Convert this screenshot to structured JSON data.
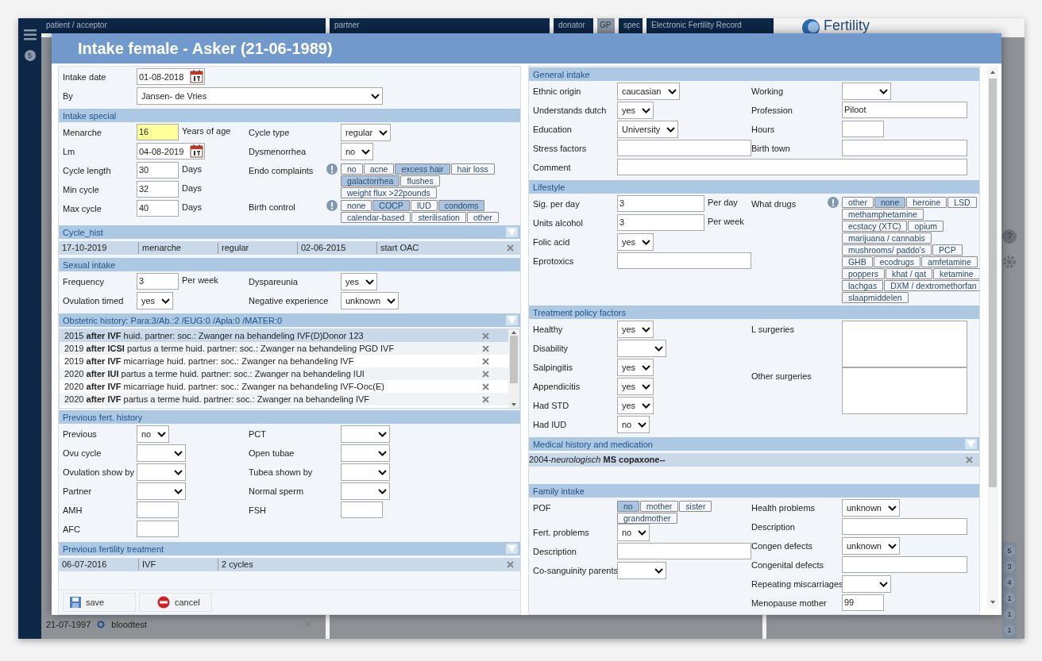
{
  "app": {
    "menu_badge": "5",
    "header": [
      {
        "label": "patient / acceptor",
        "kind": "bar"
      },
      {
        "label": "partner",
        "kind": "bar"
      },
      {
        "label": "donator",
        "kind": "bar"
      },
      {
        "label": "GP",
        "kind": "tab"
      },
      {
        "label": "spec",
        "kind": "bar"
      },
      {
        "label": "Electronic Fertility Record",
        "kind": "bar"
      }
    ],
    "logo": "Fertility",
    "help": "?",
    "side_badges": [
      "5",
      "3",
      "4",
      "1",
      "1",
      "1"
    ],
    "bottom_entry": {
      "date": "21-07-1997",
      "label": "bloodtest"
    }
  },
  "dialog": {
    "title": "Intake female - Asker (21-06-1989)",
    "left": [
      {
        "kind": "form",
        "left": [
          {
            "label": "Intake date",
            "kind": "date",
            "value": "01-08-2018"
          },
          {
            "label": "By",
            "kind": "select",
            "value": "Jansen- de Vries"
          }
        ]
      },
      {
        "title": "Intake special",
        "kind": "form",
        "collapsible": false,
        "left": [
          {
            "label": "Menarche",
            "kind": "number",
            "value": "16",
            "unit": "Years of age",
            "highlighted": true
          },
          {
            "label": "Lm",
            "kind": "date",
            "value": "04-08-2019"
          },
          {
            "label": "Cycle length",
            "kind": "number",
            "value": "30",
            "unit": "Days"
          },
          {
            "label": "Min cycle",
            "kind": "number",
            "value": "32",
            "unit": "Days"
          },
          {
            "label": "Max cycle",
            "kind": "number",
            "value": "40",
            "unit": "Days"
          }
        ],
        "right": [
          {
            "label": "Cycle type",
            "kind": "select",
            "value": "regular"
          },
          {
            "label": "Dysmenorrhea",
            "kind": "select",
            "value": "no"
          },
          {
            "label": "Endo complaints",
            "kind": "chips",
            "warning": true,
            "options": [
              {
                "label": "no",
                "selected": false
              },
              {
                "label": "acne",
                "selected": false
              },
              {
                "label": "excess hair",
                "selected": true
              },
              {
                "label": "hair loss",
                "selected": false
              },
              {
                "label": "galactorrhea",
                "selected": true
              },
              {
                "label": "flushes",
                "selected": false
              },
              {
                "label": "weight flux >22pounds",
                "selected": false
              }
            ]
          },
          {
            "label": "Birth control",
            "kind": "chips",
            "warning": true,
            "options": [
              {
                "label": "none",
                "selected": false
              },
              {
                "label": "COCP",
                "selected": true
              },
              {
                "label": "IUD",
                "selected": false
              },
              {
                "label": "condoms",
                "selected": true
              },
              {
                "label": "calendar-based",
                "selected": false
              },
              {
                "label": "sterilisation",
                "selected": false
              },
              {
                "label": "other",
                "selected": false
              }
            ]
          }
        ]
      },
      {
        "title": "Cycle_hist",
        "kind": "table",
        "collapsible": true,
        "rows": [
          {
            "cells": [
              "17-10-2019",
              "menarche",
              "regular",
              "02-06-2015",
              "start OAC"
            ]
          }
        ]
      },
      {
        "title": "Sexual intake",
        "kind": "form",
        "collapsible": false,
        "left": [
          {
            "label": "Frequency",
            "kind": "number",
            "value": "3",
            "unit": "Per week"
          },
          {
            "label": "Ovulation timed",
            "kind": "select",
            "value": "yes"
          }
        ],
        "right": [
          {
            "label": "Dyspareunia",
            "kind": "select",
            "value": "yes"
          },
          {
            "label": "Negative experience",
            "kind": "select",
            "value": "unknown"
          }
        ]
      },
      {
        "title": "Obstetric history: Para:3/Ab.:2 /EUG:0 /Apla:0 /MATER:0",
        "kind": "list",
        "collapsible": true,
        "rows": [
          {
            "text": "2015 **after IVF** huid. partner: soc.: Zwanger na behandeling IVF(D)Donor 123",
            "selected": true
          },
          {
            "text": "2019 **after ICSI** partus a terme huid. partner: soc.: Zwanger na behandeling PGD IVF",
            "selected": false
          },
          {
            "text": "2019 **after IVF** micarriage huid. partner: soc.: Zwanger na behandeling IVF",
            "selected": false
          },
          {
            "text": "2020 **after IUI** partus a terme huid. partner: soc.: Zwanger na behandeling IUI",
            "selected": false
          },
          {
            "text": "2020 **after IVF** micarriage huid. partner: soc.: Zwanger na behandeling IVF-Ooc(E)",
            "selected": false
          },
          {
            "text": "2020 **after IVF** partus a terme huid. partner: soc.: Zwanger na behandeling IVF",
            "selected": false
          }
        ]
      },
      {
        "title": "Previous fert. history",
        "kind": "form",
        "collapsible": false,
        "left": [
          {
            "label": "Previous",
            "kind": "select",
            "value": "no"
          },
          {
            "label": "Ovu cycle",
            "kind": "select"
          },
          {
            "label": "Ovulation show by",
            "kind": "select"
          },
          {
            "label": "Partner",
            "kind": "select"
          },
          {
            "label": "AMH",
            "kind": "number"
          },
          {
            "label": "AFC",
            "kind": "number"
          }
        ],
        "right": [
          {
            "label": "PCT",
            "kind": "select"
          },
          {
            "label": "Open tubae",
            "kind": "select"
          },
          {
            "label": "Tubea shown by",
            "kind": "select"
          },
          {
            "label": "Normal sperm",
            "kind": "select"
          },
          {
            "label": "FSH",
            "kind": "number"
          }
        ]
      },
      {
        "title": "Previous fertility treatment",
        "kind": "table",
        "collapsible": true,
        "rows": [
          {
            "cells": [
              "06-07-2016",
              "IVF",
              "2 cycles"
            ]
          }
        ]
      }
    ],
    "right": [
      {
        "title": "General intake",
        "kind": "form",
        "collapsible": false,
        "left": [
          {
            "label": "Ethnic origin",
            "kind": "select",
            "value": "caucasian"
          },
          {
            "label": "Understands dutch",
            "kind": "select",
            "value": "yes"
          },
          {
            "label": "Education",
            "kind": "select",
            "value": "University"
          },
          {
            "label": "Stress factors",
            "kind": "text"
          }
        ],
        "right": [
          {
            "label": "Working",
            "kind": "select"
          },
          {
            "label": "Profession",
            "kind": "text",
            "value": "Piloot"
          },
          {
            "label": "Hours",
            "kind": "number"
          },
          {
            "label": "Birth town",
            "kind": "text"
          }
        ],
        "wide": [
          {
            "label": "Comment",
            "kind": "text"
          }
        ]
      },
      {
        "title": "Lifestyle",
        "kind": "form",
        "collapsible": false,
        "left": [
          {
            "label": "Sig. per day",
            "kind": "text",
            "value": "3",
            "unit": "Per day"
          },
          {
            "label": "Units alcohol",
            "kind": "text",
            "value": "3",
            "unit": "Per week"
          },
          {
            "label": "Folic acid",
            "kind": "select",
            "value": "yes"
          },
          {
            "label": "Eprotoxics",
            "kind": "text"
          }
        ],
        "right": [
          {
            "label": "What drugs",
            "kind": "chips",
            "warning": true,
            "options": [
              {
                "label": "other",
                "selected": false
              },
              {
                "label": "none",
                "selected": true
              },
              {
                "label": "heroine",
                "selected": false
              },
              {
                "label": "LSD",
                "selected": false
              },
              {
                "label": "methamphetamine",
                "selected": false
              },
              {
                "label": "ecstacy (XTC)",
                "selected": false
              },
              {
                "label": "opium",
                "selected": false
              },
              {
                "label": "marijuana / cannabis",
                "selected": false
              },
              {
                "label": "mushrooms/ paddo's",
                "selected": false
              },
              {
                "label": "PCP",
                "selected": false
              },
              {
                "label": "GHB",
                "selected": false
              },
              {
                "label": "ecodrugs",
                "selected": false
              },
              {
                "label": "amfetamine",
                "selected": false
              },
              {
                "label": "poppers",
                "selected": false
              },
              {
                "label": "khat / qat",
                "selected": false
              },
              {
                "label": "ketamine",
                "selected": false
              },
              {
                "label": "lachgas",
                "selected": false
              },
              {
                "label": "DXM / dextromethorfan",
                "selected": false
              },
              {
                "label": "slaapmiddelen",
                "selected": false
              }
            ]
          }
        ]
      },
      {
        "title": "Treatment policy factors",
        "kind": "form",
        "collapsible": false,
        "left": [
          {
            "label": "Healthy",
            "kind": "select",
            "value": "yes"
          },
          {
            "label": "Disability",
            "kind": "select"
          },
          {
            "label": "Salpingitis",
            "kind": "select",
            "value": "yes"
          },
          {
            "label": "Appendicitis",
            "kind": "select",
            "value": "yes"
          },
          {
            "label": "Had STD",
            "kind": "select",
            "value": "yes"
          },
          {
            "label": "Had IUD",
            "kind": "select",
            "value": "no"
          }
        ],
        "right": [
          {
            "label": "L surgeries",
            "kind": "textarea"
          },
          {
            "label": "Other surgeries",
            "kind": "textarea"
          }
        ]
      },
      {
        "title": "Medical history and medication",
        "kind": "table",
        "collapsible": true,
        "rows": [
          {
            "cells": [
              "2004-*neurologisch* **MS copaxone--**"
            ]
          }
        ]
      },
      {
        "title": "Family intake",
        "kind": "form",
        "collapsible": false,
        "left": [
          {
            "label": "POF",
            "kind": "chips",
            "options": [
              {
                "label": "no",
                "selected": true
              },
              {
                "label": "mother",
                "selected": false
              },
              {
                "label": "sister",
                "selected": false
              },
              {
                "label": "grandmother",
                "selected": false
              }
            ]
          },
          {
            "label": "Fert. problems",
            "kind": "select",
            "value": "no"
          },
          {
            "label": "Description",
            "kind": "text"
          },
          {
            "label": "Co-sanguinity parents",
            "kind": "select"
          }
        ],
        "right": [
          {
            "label": "Health problems",
            "kind": "select",
            "value": "unknown"
          },
          {
            "label": "Description",
            "kind": "text"
          },
          {
            "label": "Congen defects",
            "kind": "select",
            "value": "unknown"
          },
          {
            "label": "Congenital defects",
            "kind": "text"
          },
          {
            "label": "Repeating miscarriages",
            "kind": "select"
          },
          {
            "label": "Menopause mother",
            "kind": "number",
            "value": "99"
          }
        ]
      }
    ],
    "buttons": [
      {
        "label": "save",
        "kind": "save"
      },
      {
        "label": "cancel",
        "kind": "cancel"
      }
    ]
  }
}
